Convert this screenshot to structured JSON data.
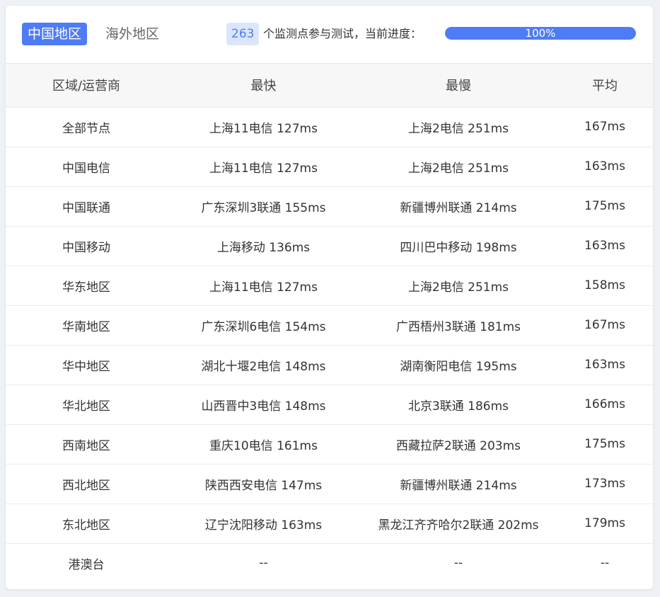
{
  "tabs": {
    "domestic": "中国地区",
    "overseas": "海外地区"
  },
  "status": {
    "node_count": "263",
    "progress_text": "个监测点参与测试，当前进度：",
    "progress_percent": 100,
    "progress_label": "100%"
  },
  "colors": {
    "accent": "#4e7cf6",
    "badge_bg": "#dbe6fd"
  },
  "table": {
    "headers": [
      "区域/运营商",
      "最快",
      "最慢",
      "平均"
    ],
    "rows": [
      [
        "全部节点",
        "上海11电信 127ms",
        "上海2电信 251ms",
        "167ms"
      ],
      [
        "中国电信",
        "上海11电信 127ms",
        "上海2电信 251ms",
        "163ms"
      ],
      [
        "中国联通",
        "广东深圳3联通 155ms",
        "新疆博州联通 214ms",
        "175ms"
      ],
      [
        "中国移动",
        "上海移动 136ms",
        "四川巴中移动 198ms",
        "163ms"
      ],
      [
        "华东地区",
        "上海11电信 127ms",
        "上海2电信 251ms",
        "158ms"
      ],
      [
        "华南地区",
        "广东深圳6电信 154ms",
        "广西梧州3联通 181ms",
        "167ms"
      ],
      [
        "华中地区",
        "湖北十堰2电信 148ms",
        "湖南衡阳电信 195ms",
        "163ms"
      ],
      [
        "华北地区",
        "山西晋中3电信 148ms",
        "北京3联通 186ms",
        "166ms"
      ],
      [
        "西南地区",
        "重庆10电信 161ms",
        "西藏拉萨2联通 203ms",
        "175ms"
      ],
      [
        "西北地区",
        "陕西西安电信 147ms",
        "新疆博州联通 214ms",
        "173ms"
      ],
      [
        "东北地区",
        "辽宁沈阳移动 163ms",
        "黑龙江齐齐哈尔2联通 202ms",
        "179ms"
      ],
      [
        "港澳台",
        "--",
        "--",
        "--"
      ]
    ]
  }
}
